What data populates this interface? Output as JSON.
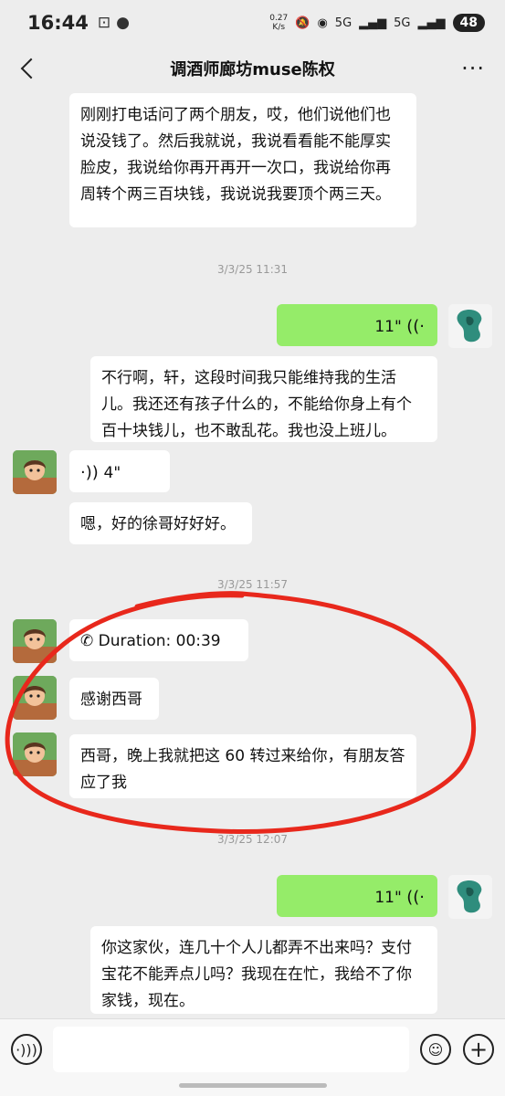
{
  "status_bar": {
    "time": "16:44",
    "net_speed_top": "0.27",
    "net_speed_bottom": "K/s",
    "signal_1": "5G",
    "signal_2": "5G",
    "battery": "48"
  },
  "header": {
    "title": "调酒师廊坊muse陈权",
    "more": "···"
  },
  "messages": {
    "m1": "刚刚打电话问了两个朋友，哎，他们说他们也说没钱了。然后我就说，我说看看能不能厚实脸皮，我说给你再开再开一次口，我说给你再周转个两三百块钱，我说说我要顶个两三天。",
    "t1": "3/3/25 11:31",
    "m2_duration": "11\"",
    "m3": "不行啊，轩，这段时间我只能维持我的生活儿。我还还有孩子什么的，不能给你身上有个百十块钱儿，也不敢乱花。我也没上班儿。",
    "m4_duration": "4\"",
    "m5": "嗯，好的徐哥好好好。",
    "t2": "3/3/25 11:57",
    "m6": "Duration: 00:39",
    "m7": "感谢西哥",
    "m8": "西哥，晚上我就把这 60 转过来给你，有朋友答应了我",
    "t3": "3/3/25 12:07",
    "m9_duration": "11\"",
    "m10": "你这家伙，连几十个人儿都弄不出来吗？支付宝花不能弄点儿吗？我现在在忙，我给不了你家钱，现在。"
  },
  "icons": {
    "back": "back-arrow-icon",
    "more": "more-icon",
    "voice_input": "voice-input-icon",
    "emoji": "emoji-icon",
    "plus": "plus-icon"
  },
  "colors": {
    "sent_bubble": "#95ec69",
    "received_bubble": "#ffffff",
    "background": "#ededed",
    "annotation": "#e8281c"
  }
}
